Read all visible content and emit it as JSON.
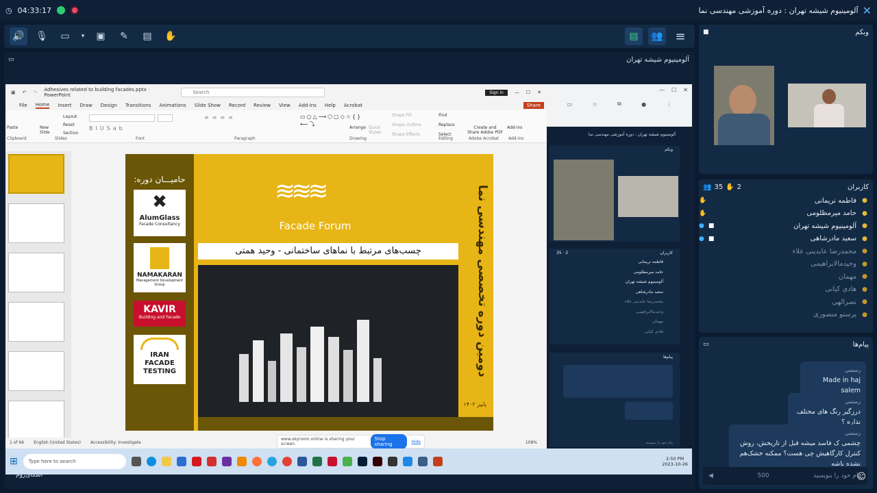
{
  "topbar": {
    "time": "04:33:17",
    "meeting_title": "آلومینیوم شیشه تهران : دوره آموزشی مهندسی نما"
  },
  "share": {
    "presenter_title": "آلومینیوم شیشه تهران"
  },
  "ppt": {
    "filename": "Adhesives related to building facades.pptx  ·  PowerPoint",
    "search_placeholder": "Search",
    "sign_in": "Sign in",
    "share": "Share",
    "menu": [
      "File",
      "Home",
      "Insert",
      "Draw",
      "Design",
      "Transitions",
      "Animations",
      "Slide Show",
      "Record",
      "Review",
      "View",
      "Add-ins",
      "Help",
      "Acrobat"
    ],
    "ribbon_groups": [
      "Clipboard",
      "Slides",
      "Font",
      "Paragraph",
      "Drawing",
      "Editing",
      "Adobe Acrobat",
      "Add-ins"
    ],
    "ribbon_buttons": {
      "paste": "Paste",
      "new_slide": "New Slide",
      "layout": "Layout",
      "reset": "Reset",
      "section": "Section",
      "arrange": "Arrange",
      "quick_styles": "Quick Styles",
      "shape_fill": "Shape Fill",
      "shape_outline": "Shape Outline",
      "shape_effects": "Shape Effects",
      "find": "Find",
      "replace": "Replace",
      "select": "Select",
      "create_pdf": "Create and Share Adobe PDF",
      "addins": "Add-ins"
    },
    "status": {
      "slide_count": "1 of 66",
      "language": "English (United States)",
      "accessibility": "Accessibility: Investigate",
      "zoom": "108%"
    },
    "slide": {
      "sponsors_label": "حامیـــان دوره:",
      "brand": "Facade Forum",
      "title": "چسب‌های مرتبط با نماهای ساختمانی - وحید همتی",
      "vertical_title": "دومین دوره تخصصی مهندسی نما",
      "season": "پاییز ۱۴۰۲",
      "sponsors": [
        {
          "name": "AlumGlass",
          "sub": "Facade Consultancy"
        },
        {
          "name": "NAMAKARAN",
          "sub": "Management Development Group"
        },
        {
          "name": "KAVIR",
          "sub": "Building and Facade"
        },
        {
          "name": "IRAN FACADE TESTING",
          "sub": ""
        }
      ]
    }
  },
  "sharing_bar": {
    "text": "www.skyroom.online is sharing your screen.",
    "stop": "Stop sharing",
    "hide": "Hide"
  },
  "taskbar": {
    "search_placeholder": "Type here to search",
    "time": "2:50 PM",
    "date": "2023-10-26"
  },
  "mirror": {
    "title": "آلومینیوم شیشه تهران : دوره آموزشی مهندسی نما",
    "webcam": "وبکم",
    "users": "کاربران",
    "count_a": "35",
    "count_b": "2",
    "messages": "پیام‌ها",
    "input_placeholder": "پیام خود را بنویسید"
  },
  "right": {
    "webcam_label": "وبکم",
    "users_label": "کاربران",
    "users_count": "35",
    "hands_count": "2",
    "users": [
      {
        "name": "فاطمه نریمانی",
        "dim": false
      },
      {
        "name": "حامد میرمظلومی",
        "dim": false
      },
      {
        "name": "آلومینیوم شیشه تهران",
        "dim": false
      },
      {
        "name": "سعید مادرشاهی",
        "dim": false
      },
      {
        "name": "محمدرضا عابدینی علاء",
        "dim": true
      },
      {
        "name": "وحیدمالابراهیمی",
        "dim": true
      },
      {
        "name": "مهمان",
        "dim": true
      },
      {
        "name": "هادی کیانی",
        "dim": true
      },
      {
        "name": "نصرالهی",
        "dim": true
      },
      {
        "name": "پرستو منصوری",
        "dim": true
      }
    ],
    "messages_label": "پیام‌ها",
    "messages": [
      {
        "sender": "رستمی",
        "text": "Made in haj salem 󠀠"
      },
      {
        "sender": "رستمی",
        "text": "درزگیر رنگ های مختلف نداره ؟"
      },
      {
        "sender": "رستمی",
        "text": "چشمی ک فاسد میشه قبل از تاریخش، روش کنترل کارگاهیش چی هست؟ ممکنه خشک‌هم نشده باشه"
      }
    ],
    "chat_placeholder": "پیام خود را بنویسید",
    "chat_counter": "500"
  },
  "brand": "اسکای‌روم™",
  "colors": {
    "bg": "#0b1a2e",
    "panel": "#132a44",
    "accent": "#58b4ff",
    "slide_yellow": "#e8b516",
    "slide_dark": "#6a5606"
  }
}
